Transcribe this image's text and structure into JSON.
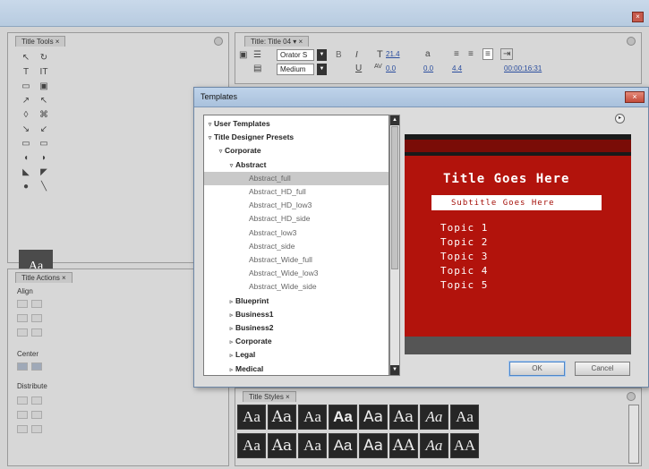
{
  "window": {
    "close_glyph": "×"
  },
  "title_tools": {
    "tab_label": "Title Tools ×",
    "tools": [
      "↖",
      "↻",
      "T",
      "IT",
      "▭",
      "▣",
      "↗",
      "↖",
      "◊",
      "⌘",
      "↘",
      "↙",
      "▭",
      "▭",
      "◖",
      "◗",
      "◣",
      "◤",
      "●",
      "╲"
    ],
    "swatch_text": "Aa"
  },
  "title_actions": {
    "tab_label": "Title Actions ×",
    "align_label": "Align",
    "center_label": "Center",
    "distribute_label": "Distribute"
  },
  "title_panel": {
    "tab_label": "Title: Title 04 ▾ ×",
    "font_family": "Orator S",
    "font_style": "Medium",
    "font_size": "21.4",
    "kerning": "0.0",
    "tracking": "0.0",
    "leading": "4.4",
    "timecode": "00:00:16:31"
  },
  "title_styles": {
    "tab_label": "Title Styles ×",
    "row1": [
      "Aa",
      "Aa",
      "Aa",
      "Aa",
      "Aa",
      "Aa",
      "Aa",
      "Aa"
    ],
    "row2": [
      "Aa",
      "Aa",
      "Aa",
      "Aa",
      "Aa",
      "AA",
      "Aa",
      "AA"
    ]
  },
  "templates_dialog": {
    "title": "Templates",
    "close_glyph": "×",
    "tree": [
      {
        "label": "User Templates",
        "level": 0,
        "bold": true,
        "tri": "▿"
      },
      {
        "label": "Title Designer Presets",
        "level": 0,
        "bold": true,
        "tri": "▿"
      },
      {
        "label": "Corporate",
        "level": 1,
        "bold": true,
        "tri": "▿"
      },
      {
        "label": "Abstract",
        "level": 2,
        "bold": true,
        "tri": "▿"
      },
      {
        "label": "Abstract_full",
        "level": 3,
        "bold": false,
        "tri": "",
        "selected": true
      },
      {
        "label": "Abstract_HD_full",
        "level": 3,
        "bold": false,
        "tri": ""
      },
      {
        "label": "Abstract_HD_low3",
        "level": 3,
        "bold": false,
        "tri": ""
      },
      {
        "label": "Abstract_HD_side",
        "level": 3,
        "bold": false,
        "tri": ""
      },
      {
        "label": "Abstract_low3",
        "level": 3,
        "bold": false,
        "tri": ""
      },
      {
        "label": "Abstract_side",
        "level": 3,
        "bold": false,
        "tri": ""
      },
      {
        "label": "Abstract_Wide_full",
        "level": 3,
        "bold": false,
        "tri": ""
      },
      {
        "label": "Abstract_Wide_low3",
        "level": 3,
        "bold": false,
        "tri": ""
      },
      {
        "label": "Abstract_Wide_side",
        "level": 3,
        "bold": false,
        "tri": ""
      },
      {
        "label": "Blueprint",
        "level": 2,
        "bold": true,
        "tri": "▹"
      },
      {
        "label": "Business1",
        "level": 2,
        "bold": true,
        "tri": "▹"
      },
      {
        "label": "Business2",
        "level": 2,
        "bold": true,
        "tri": "▹"
      },
      {
        "label": "Corporate",
        "level": 2,
        "bold": true,
        "tri": "▹"
      },
      {
        "label": "Legal",
        "level": 2,
        "bold": true,
        "tri": "▹"
      },
      {
        "label": "Medical",
        "level": 2,
        "bold": true,
        "tri": "▹"
      }
    ],
    "preview": {
      "title": "Title Goes Here",
      "subtitle": "Subtitle Goes Here",
      "topics": [
        "Topic 1",
        "Topic 2",
        "Topic 3",
        "Topic 4",
        "Topic 5"
      ]
    },
    "ok_label": "OK",
    "cancel_label": "Cancel"
  }
}
